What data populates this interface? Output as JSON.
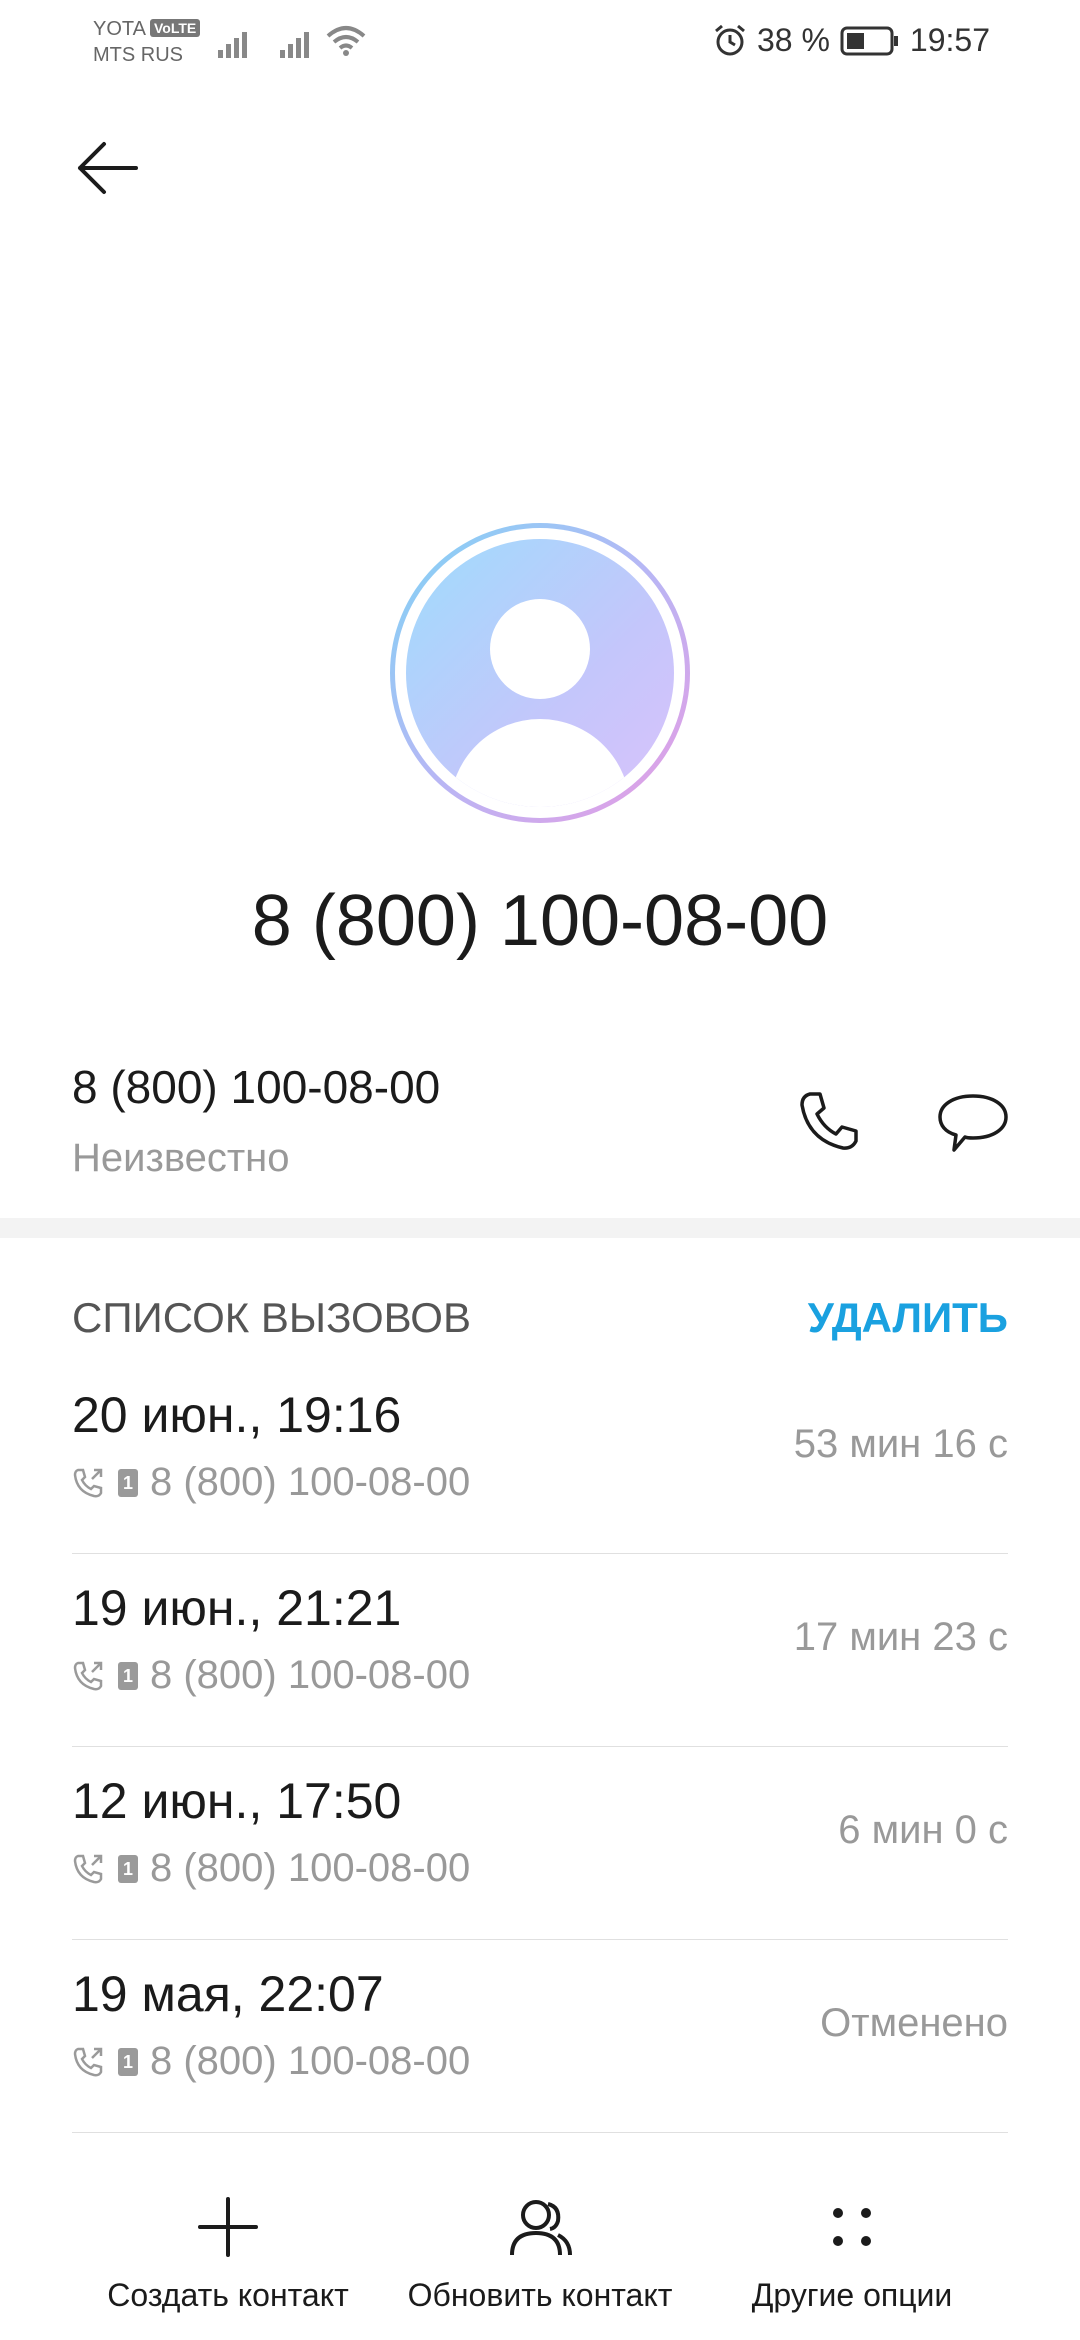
{
  "status_bar": {
    "carrier1": "YOTA",
    "volte": "VoLTE",
    "carrier2": "MTS RUS",
    "battery_percent": "38 %",
    "time": "19:57"
  },
  "contact": {
    "number_title": "8 (800) 100-08-00",
    "number": "8 (800) 100-08-00",
    "label": "Неизвестно"
  },
  "calls_section": {
    "title": "СПИСОК ВЫЗОВОВ",
    "delete_label": "УДАЛИТЬ"
  },
  "calls": [
    {
      "datetime": "20 июн., 19:16",
      "number": "8 (800) 100-08-00",
      "duration": "53 мин 16 с"
    },
    {
      "datetime": "19 июн., 21:21",
      "number": "8 (800) 100-08-00",
      "duration": "17 мин 23 с"
    },
    {
      "datetime": "12 июн., 17:50",
      "number": "8 (800) 100-08-00",
      "duration": "6 мин 0 с"
    },
    {
      "datetime": "19 мая, 22:07",
      "number": "8 (800) 100-08-00",
      "duration": "Отменено"
    }
  ],
  "sim_label": "1",
  "bottom_bar": {
    "create": "Создать контакт",
    "update": "Обновить контакт",
    "more": "Другие опции"
  },
  "colors": {
    "accent": "#1aa1e0",
    "secondary_text": "#999999"
  },
  "icons": [
    "back-arrow-icon",
    "phone-icon",
    "message-icon",
    "add-icon",
    "contacts-icon",
    "more-dots-icon",
    "call-outgoing-icon",
    "sim-icon",
    "alarm-icon",
    "battery-icon",
    "signal-icon",
    "wifi-icon"
  ]
}
